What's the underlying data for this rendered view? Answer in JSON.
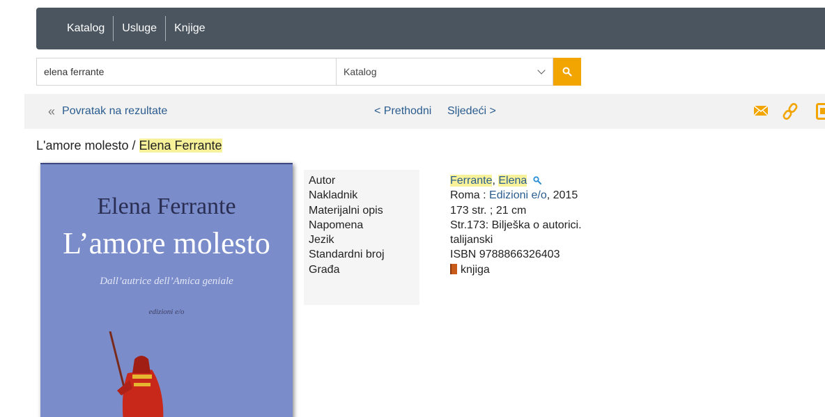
{
  "nav": {
    "items": [
      "Katalog",
      "Usluge",
      "Knjige"
    ]
  },
  "search": {
    "query": "elena ferrante",
    "scope": "Katalog"
  },
  "toolbar": {
    "back_label": "Povratak na rezultate",
    "prev_label": "< Prethodni",
    "next_label": "Sljedeći >",
    "icons": [
      "email-icon",
      "link-icon",
      "export-icon"
    ],
    "accent_color": "#f2a400"
  },
  "record": {
    "title_prefix": "L'amore molesto / ",
    "title_author": "Elena Ferrante",
    "highlight_color": "#f7f29a",
    "cover": {
      "author": "Elena Ferrante",
      "title": "L’amore molesto",
      "subtitle": "Dall’autrice dell’Amica geniale",
      "publisher": "edizioni e/o"
    },
    "labels": {
      "autor": "Autor",
      "nakladnik": "Nakladnik",
      "materijalni": "Materijalni opis",
      "napomena": "Napomena",
      "jezik": "Jezik",
      "standardni": "Standardni broj",
      "grada": "Građa"
    },
    "values": {
      "autor_last": "Ferrante",
      "autor_sep": ", ",
      "autor_first": "Elena",
      "nakladnik_place": "Roma : ",
      "nakladnik_publisher": "Edizioni e/o",
      "nakladnik_year": ", 2015",
      "materijalni": "173 str. ; 21 cm",
      "napomena": "Str.173: Bilješka o autorici.",
      "jezik": "talijanski",
      "standardni": "ISBN 9788866326403",
      "grada": "knjiga"
    }
  }
}
